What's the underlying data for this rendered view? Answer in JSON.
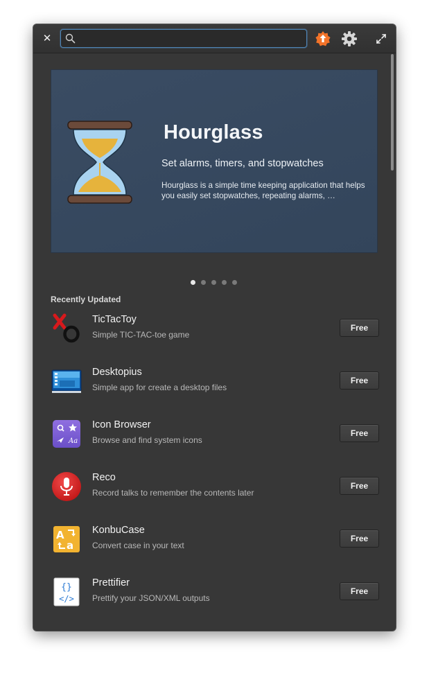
{
  "search": {
    "value": "",
    "placeholder": ""
  },
  "header_icons": {
    "close": "close-icon",
    "search": "search-icon",
    "updates": "updates-available-icon",
    "settings": "gear-icon",
    "maximize": "maximize-icon"
  },
  "banner": {
    "title": "Hourglass",
    "subtitle": "Set alarms, timers, and stopwatches",
    "description": "Hourglass is a simple time keeping application that helps you easily set stopwatches, repeating alarms, …",
    "background_color": "#3a4c63",
    "icon": "hourglass-icon"
  },
  "carousel": {
    "count": 5,
    "active_index": 0
  },
  "section": {
    "title": "Recently Updated"
  },
  "apps": [
    {
      "name": "TicTacToy",
      "summary": "Simple TIC-TAC-toe game",
      "price": "Free",
      "icon": "tictactoy-icon"
    },
    {
      "name": "Desktopius",
      "summary": "Simple app for create a desktop files",
      "price": "Free",
      "icon": "desktopius-icon"
    },
    {
      "name": "Icon Browser",
      "summary": "Browse and find system icons",
      "price": "Free",
      "icon": "icon-browser-icon"
    },
    {
      "name": "Reco",
      "summary": "Record talks to remember the contents later",
      "price": "Free",
      "icon": "microphone-icon"
    },
    {
      "name": "KonbuCase",
      "summary": "Convert case in your text",
      "price": "Free",
      "icon": "konbucase-icon"
    },
    {
      "name": "Prettifier",
      "summary": "Prettify your JSON/XML outputs",
      "price": "Free",
      "icon": "prettifier-icon"
    }
  ],
  "colors": {
    "window_bg": "#373737",
    "accent": "#4f84b5",
    "update_badge": "#f37329"
  }
}
